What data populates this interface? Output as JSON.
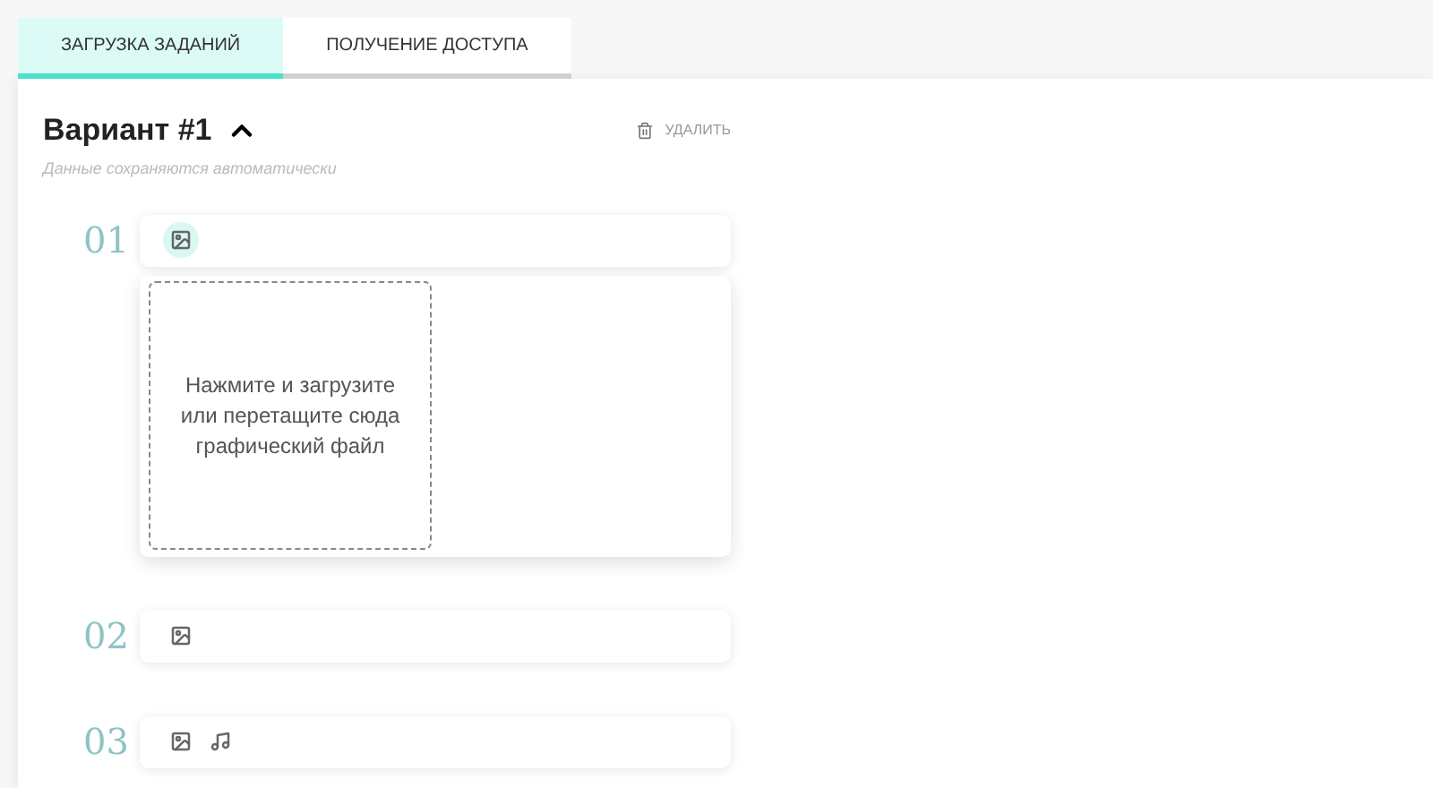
{
  "tabs": [
    {
      "label": "ЗАГРУЗКА ЗАДАНИЙ",
      "selected": true
    },
    {
      "label": "ПОЛУЧЕНИЕ ДОСТУПА",
      "selected": false
    }
  ],
  "variant": {
    "title": "Вариант #1",
    "expanded": true,
    "delete_label": "УДАЛИТЬ",
    "subtitle": "Данные сохраняются автоматически"
  },
  "tasks": [
    {
      "number": "01",
      "attachments": [
        {
          "kind": "image",
          "selected": true
        }
      ],
      "upload_hint": "Нажмите и загрузите или перетащите сюда графический файл"
    },
    {
      "number": "02",
      "attachments": [
        {
          "kind": "image",
          "selected": false
        }
      ]
    },
    {
      "number": "03",
      "attachments": [
        {
          "kind": "image",
          "selected": false
        },
        {
          "kind": "audio",
          "selected": false
        }
      ]
    }
  ]
}
